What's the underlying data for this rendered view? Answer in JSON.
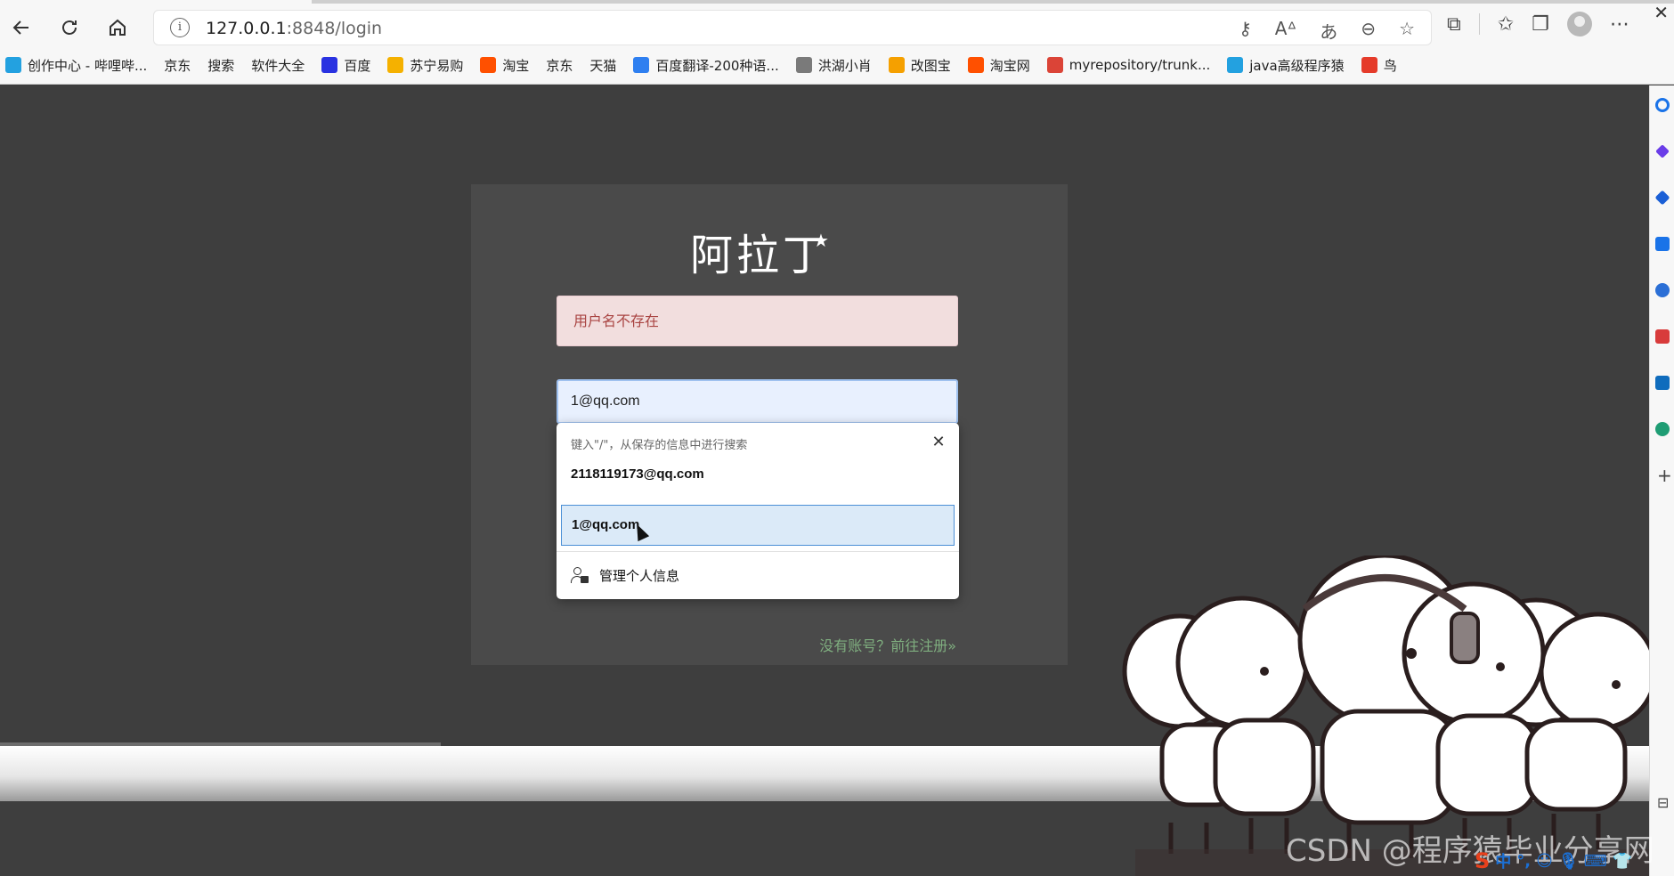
{
  "browser": {
    "url_host": "127.0.0.1",
    "url_path": ":8848/login",
    "bookmarks": [
      {
        "label": "创作中心 - 哔哩哔...",
        "icon": "bilibili-icon",
        "color": "#23a1e0"
      },
      {
        "label": "京东",
        "icon": "page-icon",
        "color": ""
      },
      {
        "label": "搜索",
        "icon": "page-icon",
        "color": ""
      },
      {
        "label": "软件大全",
        "icon": "page-icon",
        "color": ""
      },
      {
        "label": "百度",
        "icon": "baidu-paw-icon",
        "color": "#2932e1"
      },
      {
        "label": "苏宁易购",
        "icon": "suning-icon",
        "color": "#f5b100"
      },
      {
        "label": "淘宝",
        "icon": "taobao-icon",
        "color": "#ff5000"
      },
      {
        "label": "京东",
        "icon": "page-icon",
        "color": ""
      },
      {
        "label": "天猫",
        "icon": "page-icon",
        "color": ""
      },
      {
        "label": "百度翻译-200种语...",
        "icon": "baidu-translate-icon",
        "color": "#2e7ff0"
      },
      {
        "label": "洪湖小肖",
        "icon": "bird-icon",
        "color": "#7a7a7a"
      },
      {
        "label": "改图宝",
        "icon": "gaitubao-icon",
        "color": "#f5a000"
      },
      {
        "label": "淘宝网",
        "icon": "taobao-icon",
        "color": "#ff5000"
      },
      {
        "label": "myrepository/trunk...",
        "icon": "chrome-icon",
        "color": "#db4437"
      },
      {
        "label": "java高级程序猿",
        "icon": "bilibili-icon",
        "color": "#23a1e0"
      },
      {
        "label": "鸟",
        "icon": "bird-red-icon",
        "color": "#e53b2a"
      }
    ]
  },
  "login": {
    "logo_text": "阿拉丁",
    "error_message": "用户名不存在",
    "email_value": "1@qq.com",
    "register_link": "没有账号？前往注册»"
  },
  "autofill": {
    "hint": "键入\"/\"，从保存的信息中进行搜索",
    "options": [
      "2118119173@qq.com",
      "1@qq.com"
    ],
    "manage_label": "管理个人信息"
  },
  "watermark": "CSDN @程序猿毕业分享网",
  "ime": {
    "mode": "中"
  }
}
